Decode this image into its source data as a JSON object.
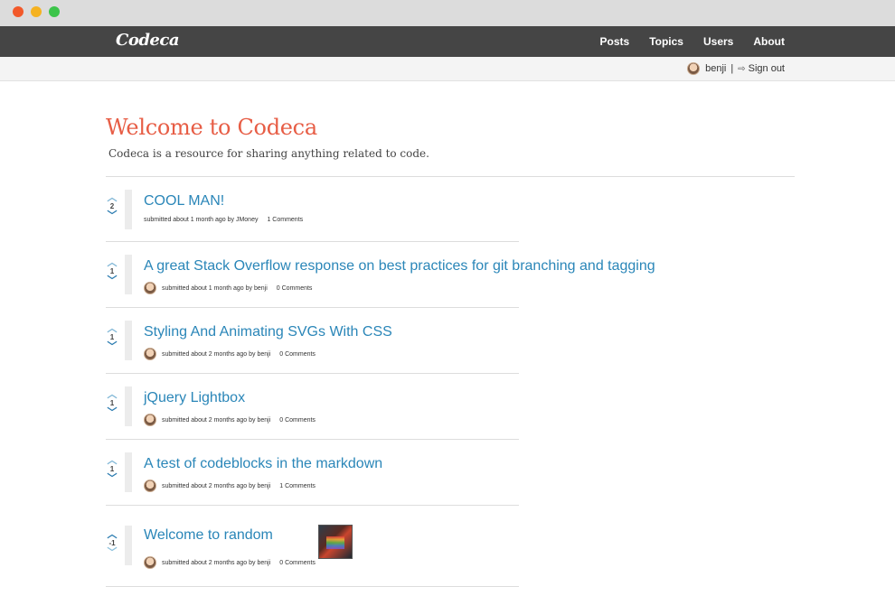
{
  "brand": "Codeca",
  "nav": [
    "Posts",
    "Topics",
    "Users",
    "About"
  ],
  "user": {
    "name": "benji",
    "separator": "|",
    "signout_label": "Sign out"
  },
  "header": {
    "title": "Welcome to Codeca",
    "subtitle": "Codeca is a resource for sharing anything related to code."
  },
  "posts": [
    {
      "votes": "2",
      "title": "COOL MAN!",
      "meta": "submitted about 1 month ago by JMoney",
      "comments": "1 Comments"
    },
    {
      "votes": "1",
      "title": "A great Stack Overflow response on best practices for git branching and tagging",
      "meta": "submitted about 1 month ago by benji",
      "comments": "0 Comments"
    },
    {
      "votes": "1",
      "title": "Styling And Animating SVGs With CSS",
      "meta": "submitted about 2 months ago by benji",
      "comments": "0 Comments"
    },
    {
      "votes": "1",
      "title": "jQuery Lightbox",
      "meta": "submitted about 2 months ago by benji",
      "comments": "0 Comments"
    },
    {
      "votes": "1",
      "title": "A test of codeblocks in the markdown",
      "meta": "submitted about 2 months ago by benji",
      "comments": "1 Comments"
    },
    {
      "votes": "-1",
      "title": "Welcome to random",
      "meta": "submitted about 2 months ago by benji",
      "comments": "0 Comments"
    }
  ],
  "icons": {
    "upvote": "chevron-up-icon",
    "downvote": "chevron-down-icon",
    "signout": "sign-out-icon"
  },
  "colors": {
    "accent_title": "#e75d45",
    "link": "#2a86b8",
    "navbar": "#454545"
  }
}
